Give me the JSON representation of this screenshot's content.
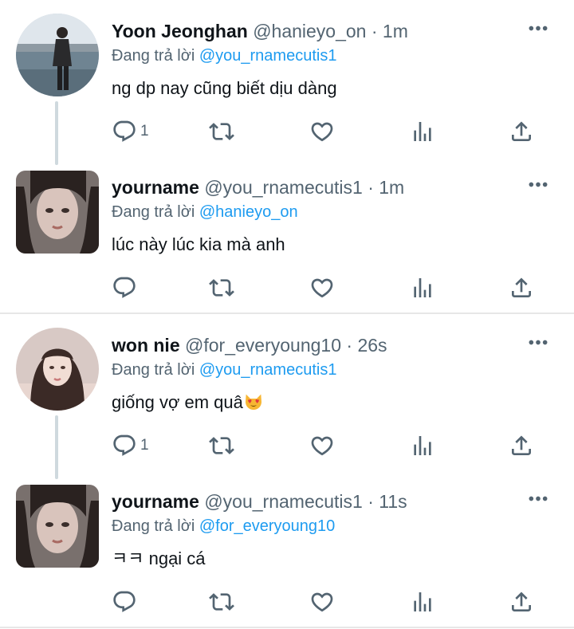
{
  "tweets": [
    {
      "name": "Yoon Jeonghan",
      "handle": "@hanieyo_on",
      "time": "· 1m",
      "reply_prefix": "Đang trả lời",
      "reply_to": "@you_rnamecutis1",
      "text": "ng dp nay cũng biết dịu dàng",
      "reply_count": "1"
    },
    {
      "name": "yourname",
      "handle": "@you_rnamecutis1",
      "time": "· 1m",
      "reply_prefix": "Đang trả lời",
      "reply_to": "@hanieyo_on",
      "text": "lúc này lúc kia mà anh",
      "reply_count": ""
    },
    {
      "name": "won nie",
      "handle": "@for_everyoung10",
      "time": "· 26s",
      "reply_prefix": "Đang trả lời",
      "reply_to": "@you_rnamecutis1",
      "text": "giống vợ em quâ",
      "reply_count": "1"
    },
    {
      "name": "yourname",
      "handle": "@you_rnamecutis1",
      "time": "· 11s",
      "reply_prefix": "Đang trả lời",
      "reply_to": "@for_everyoung10",
      "text": "ㅋㅋ ngại cá",
      "reply_count": ""
    }
  ],
  "colors": {
    "link": "#1d9bf0",
    "secondary": "#536471",
    "icon": "#536471",
    "separator": "#e7e7e7",
    "thread_line": "#cfd9de"
  },
  "icons": [
    "more-icon",
    "reply-icon",
    "retweet-icon",
    "like-icon",
    "views-icon",
    "share-icon",
    "heart-eyes-cat-emoji"
  ]
}
